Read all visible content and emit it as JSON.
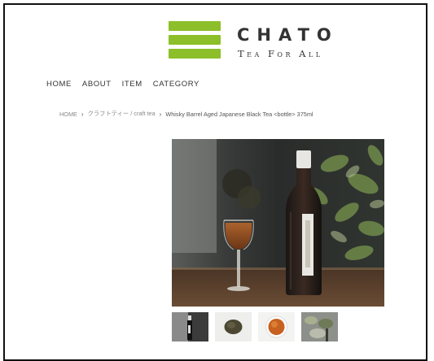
{
  "brand": {
    "name": "CHATO",
    "tagline": "Tea For All",
    "logo_color": "#8cbf2a",
    "logo_icon": "three-bars-logo-icon"
  },
  "nav": {
    "items": [
      "HOME",
      "ABOUT",
      "ITEM",
      "CATEGORY"
    ]
  },
  "breadcrumb": {
    "home": "HOME",
    "category": "クラフトティー / craft tea",
    "separator": "›",
    "current": "Whisky Barrel Aged Japanese Black Tea <bottle> 375ml"
  },
  "product_images": {
    "main": "bottle-and-glass-photo",
    "thumbnails": [
      "bottle-thumbnail",
      "tea-leaves-thumbnail",
      "tea-cup-thumbnail",
      "plant-thumbnail"
    ]
  }
}
